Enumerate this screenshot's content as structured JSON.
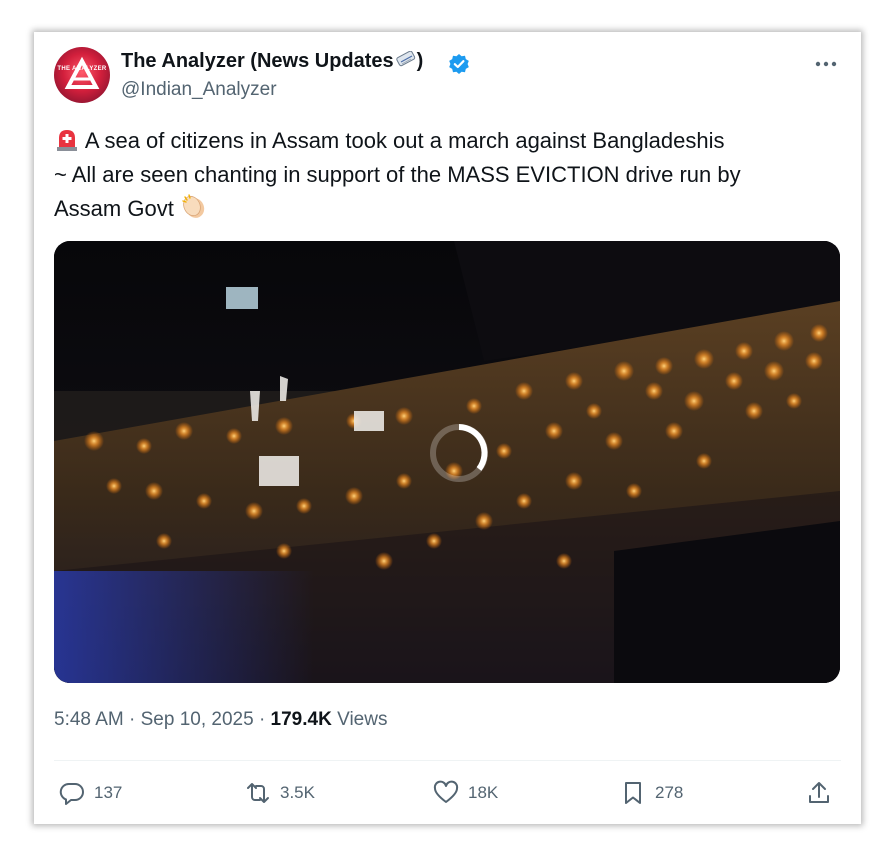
{
  "author": {
    "display_name": "The Analyzer (News Updates",
    "display_name_suffix": ")",
    "handle": "@Indian_Analyzer",
    "avatar_text": "THE ANALYZER",
    "verified_color": "#1d9bf0"
  },
  "tweet": {
    "text_line1": "A sea of citizens in Assam took out a march against Bangladeshis",
    "text_line2": "~ All are seen chanting in support of the MASS EVICTION drive run by",
    "text_line3": "Assam Govt",
    "lead_emoji": "rotating-light-icon",
    "trail_emoji": "clapping-hands-icon"
  },
  "meta": {
    "time": "5:48 AM",
    "separator": "·",
    "date": "Sep 10, 2025",
    "views_count": "179.4K",
    "views_label": "Views"
  },
  "actions": {
    "replies": "137",
    "reposts": "3.5K",
    "likes": "18K",
    "bookmarks": "278"
  },
  "colors": {
    "text_primary": "#0f1419",
    "text_secondary": "#536471",
    "brand": "#1d9bf0"
  }
}
